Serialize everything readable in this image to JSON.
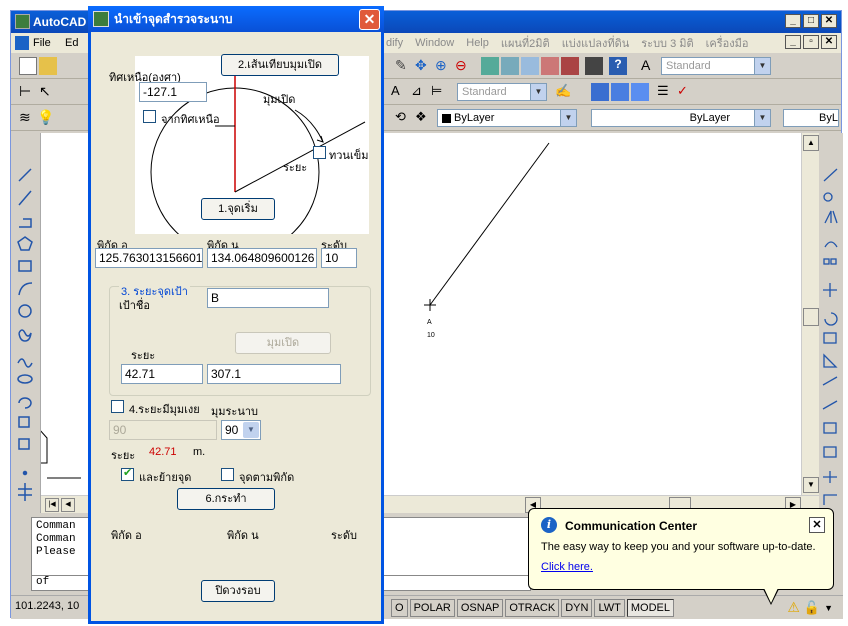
{
  "acad": {
    "title": "AutoCAD",
    "menu": [
      "dify",
      "Window",
      "Help",
      "แผนที่2มิติ",
      "แบ่งแปลงที่ดิน",
      "ระบบ 3 มิติ",
      "เครื่องมือ"
    ],
    "left_menu_fragments": [
      "File",
      "Ed"
    ],
    "combo_standard_1": "Standard",
    "combo_standard_2": "Standard",
    "combo_bylayer_1": "ByLayer",
    "combo_bylayer_2": "ByLayer",
    "combo_bylayer_3": "ByL",
    "point_label_name": "A",
    "point_label_elev": "10",
    "command_lines": [
      "Comman",
      "Comman",
      "Please"
    ],
    "command_prompt": "of",
    "status_coords": "101.2243, 10",
    "status_buttons": [
      "O",
      "POLAR",
      "OSNAP",
      "OTRACK",
      "DYN",
      "LWT",
      "MODEL"
    ]
  },
  "dialog": {
    "title": "นำเข้าจุดสำรวจระนาบ",
    "azimuth_label": "ทิศเหนือ(องศา)",
    "azimuth_value": "-127.1",
    "btn_open_line": "2.เส้นเทียบมุมเปิด",
    "label_open_angle": "มุมเปิด",
    "label_from_north": "จากทิศเหนือ",
    "label_distance_diag": "ระยะ",
    "label_ccw": "ทวนเข็ม",
    "btn_start_point": "1.จุดเริ่ม",
    "col_e": "พิกัด อ",
    "col_n": "พิกัด น",
    "col_level": "ระดับ",
    "e_value": "125.763013156601",
    "n_value": "134.064809600126",
    "level_value": "10",
    "group_title": "3. ระยะจุดเป้า",
    "target_label": "เป้าชื่อ",
    "target_value": "B",
    "distance_label": "ระยะ",
    "btn_open_angle": "มุมเปิด",
    "distance_value": "42.71",
    "angle_value": "307.1",
    "label_slope": "4.ระยะมีมุมเงย",
    "label_plane_angle": "มุมระนาบ",
    "slope_value": "90",
    "plane_angle_value": "90",
    "label_dist2": "ระยะ",
    "dist2_value": "42.71",
    "dist2_unit": "m.",
    "label_move_point": "และย้ายจุด",
    "label_by_coord": "จุดตามพิกัด",
    "btn_execute": "6.กระทำ",
    "bottom_col_e": "พิกัด อ",
    "bottom_col_n": "พิกัด น",
    "bottom_col_level": "ระดับ",
    "btn_close": "ปิดวงรอบ"
  },
  "comm": {
    "title": "Communication Center",
    "text": "The easy way to keep you and your software up-to-date.",
    "link": "Click here."
  }
}
